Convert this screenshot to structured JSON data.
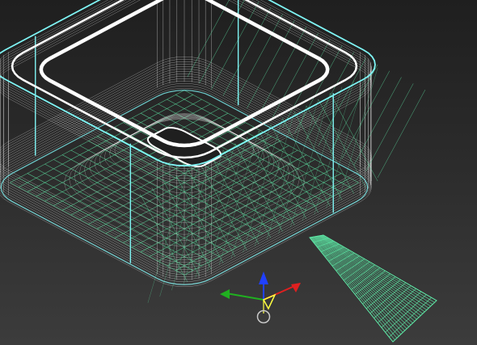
{
  "viewport": {
    "view": "perspective",
    "render_mode": "wireframe",
    "background": "#2a2a2a"
  },
  "colors": {
    "selection_outline": "#7ff5f5",
    "selected_edges": "#ffffff",
    "wire": "#5ee8a6",
    "gizmo_x": "#e02020",
    "gizmo_y": "#20b020",
    "gizmo_z": "#2040ff",
    "gizmo_center": "#ffff40",
    "gizmo_ring": "#c8c8c8"
  },
  "objects": [
    {
      "name": "tray-model",
      "type": "rounded-box-shell"
    },
    {
      "name": "ground-plane",
      "type": "plane"
    }
  ],
  "gizmo": {
    "type": "move-transform",
    "axes": [
      "x",
      "y",
      "z"
    ]
  }
}
